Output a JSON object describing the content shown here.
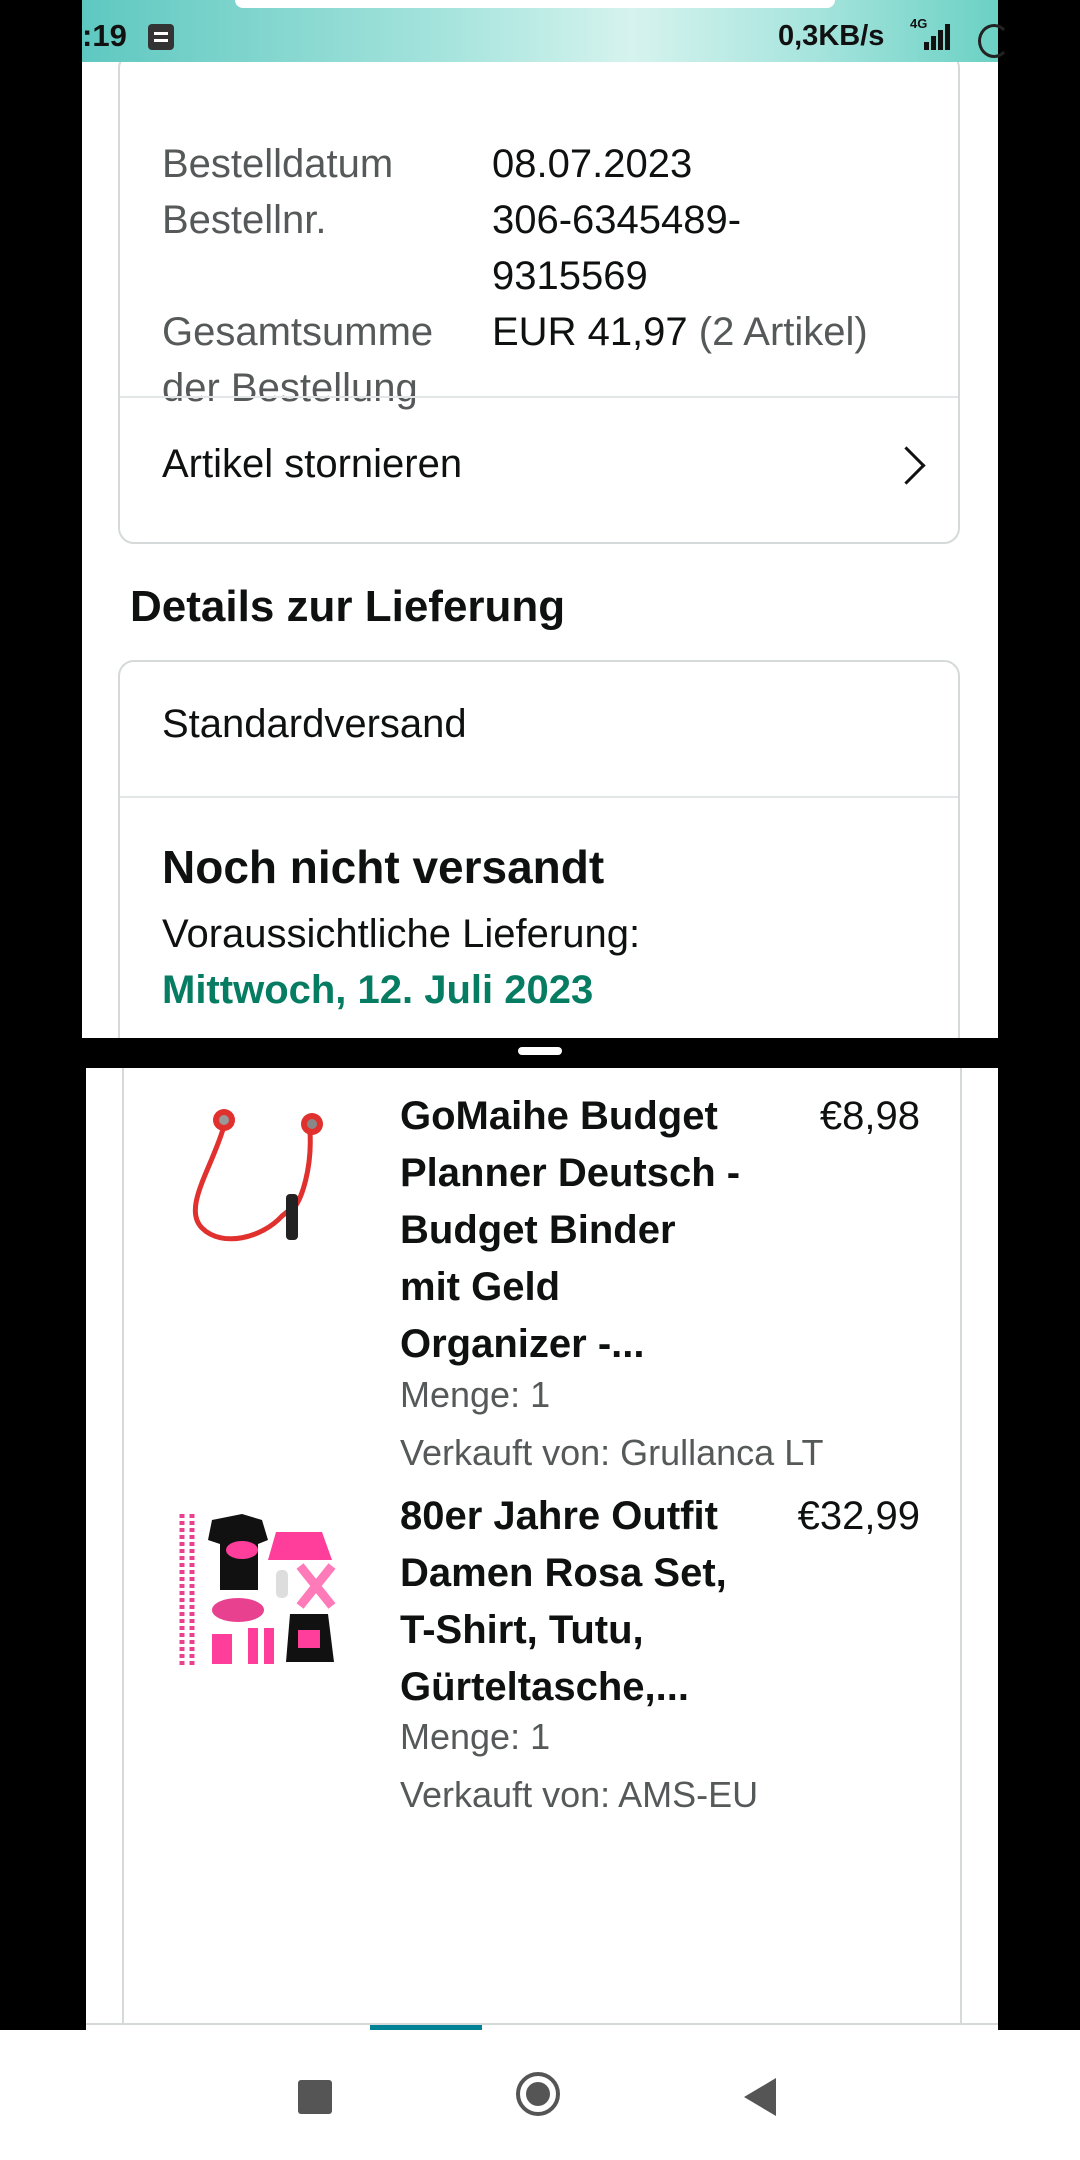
{
  "status_bar": {
    "time": ":19",
    "speed": "0,3KB/s",
    "network": "4G"
  },
  "order": {
    "date_label": "Bestelldatum",
    "date_value": "08.07.2023",
    "number_label": "Bestellnr.",
    "number_value_line1": "306-6345489-",
    "number_value_line2": "9315569",
    "total_label_line1": "Gesamtsumme",
    "total_label_line2": "der Bestellung",
    "total_value": "EUR 41,97",
    "total_items": "(2 Artikel)",
    "cancel_label": "Artikel stornieren"
  },
  "delivery": {
    "section_title": "Details zur Lieferung",
    "shipping_method": "Standardversand",
    "status": "Noch nicht versandt",
    "expected_label": "Voraussichtliche Lieferung:",
    "expected_date": "Mittwoch, 12. Juli 2023"
  },
  "items": [
    {
      "title_lines": [
        "GoMaihe Budget",
        "Planner Deutsch -",
        "Budget Binder",
        "mit Geld",
        "Organizer -..."
      ],
      "price": "€8,98",
      "quantity": "Menge: 1",
      "seller": "Verkauft von: Grullanca LT",
      "image_icon": "red-earphones-image"
    },
    {
      "title_lines": [
        "80er Jahre Outfit",
        "Damen Rosa Set,",
        "T-Shirt, Tutu,",
        "Gürteltasche,..."
      ],
      "price": "€32,99",
      "quantity": "Menge: 1",
      "seller": "Verkauft von: AMS-EU",
      "image_icon": "pink-outfit-set-image"
    }
  ],
  "colors": {
    "delivery_green": "#067d62",
    "tab_accent": "#008296"
  }
}
